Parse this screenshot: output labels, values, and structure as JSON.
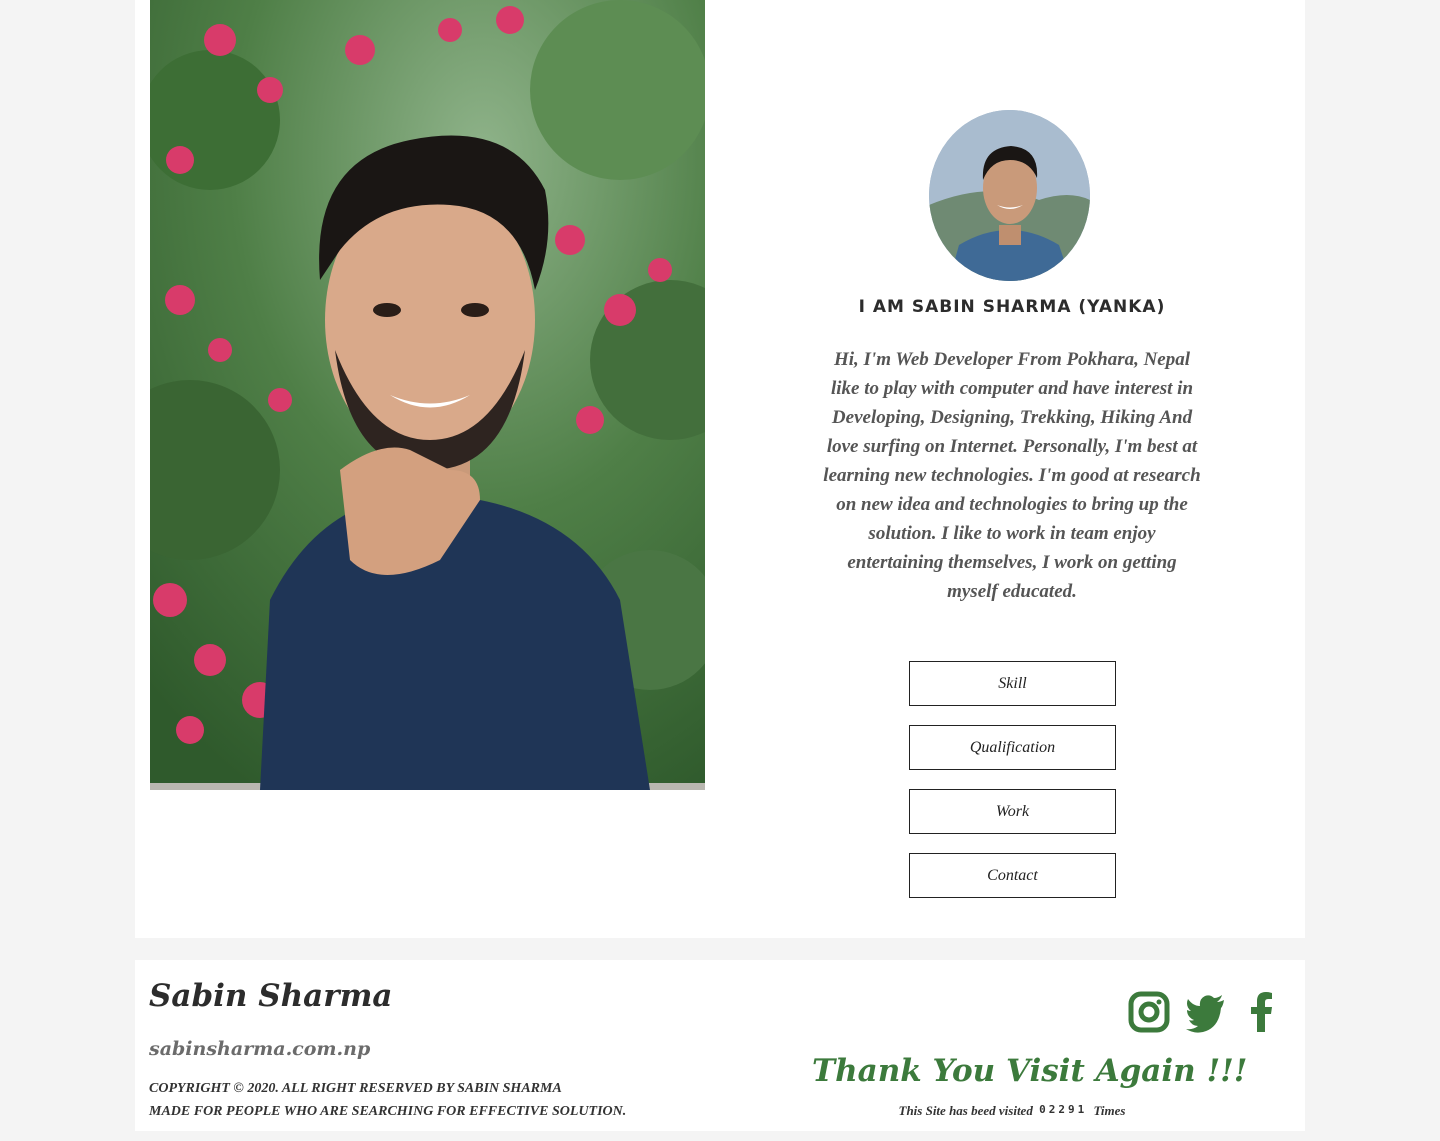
{
  "profile": {
    "headline": "I AM SABIN SHARMA (YANKA)",
    "bio": "Hi, I'm Web Developer From Pokhara, Nepal like to play with computer and have interest in Developing, Designing, Trekking, Hiking And love surfing on Internet. Personally, I'm best at learning new technologies. I'm good at research on new idea and technologies to bring up the solution. I like to work in team enjoy entertaining themselves, I work on getting myself educated."
  },
  "nav": {
    "skill": "Skill",
    "qualification": "Qualification",
    "work": "Work",
    "contact": "Contact"
  },
  "footer": {
    "name": "Sabin Sharma",
    "site": "sabinsharma.com.np",
    "copyright": "COPYRIGHT © 2020. ALL RIGHT RESERVED BY SABIN SHARMA",
    "tagline": "MADE FOR PEOPLE WHO ARE SEARCHING FOR EFFECTIVE SOLUTION.",
    "thanks": "Thank You Visit Again !!!",
    "visits_prefix": "This Site has beed visited",
    "visits_count": "02291",
    "visits_suffix": "Times"
  },
  "social": {
    "icons": [
      "instagram-icon",
      "twitter-icon",
      "facebook-icon"
    ],
    "color": "#3c7a3c"
  },
  "colors": {
    "accent_green": "#3c7a3c",
    "page_bg": "#f4f4f4",
    "card_bg": "#ffffff"
  }
}
